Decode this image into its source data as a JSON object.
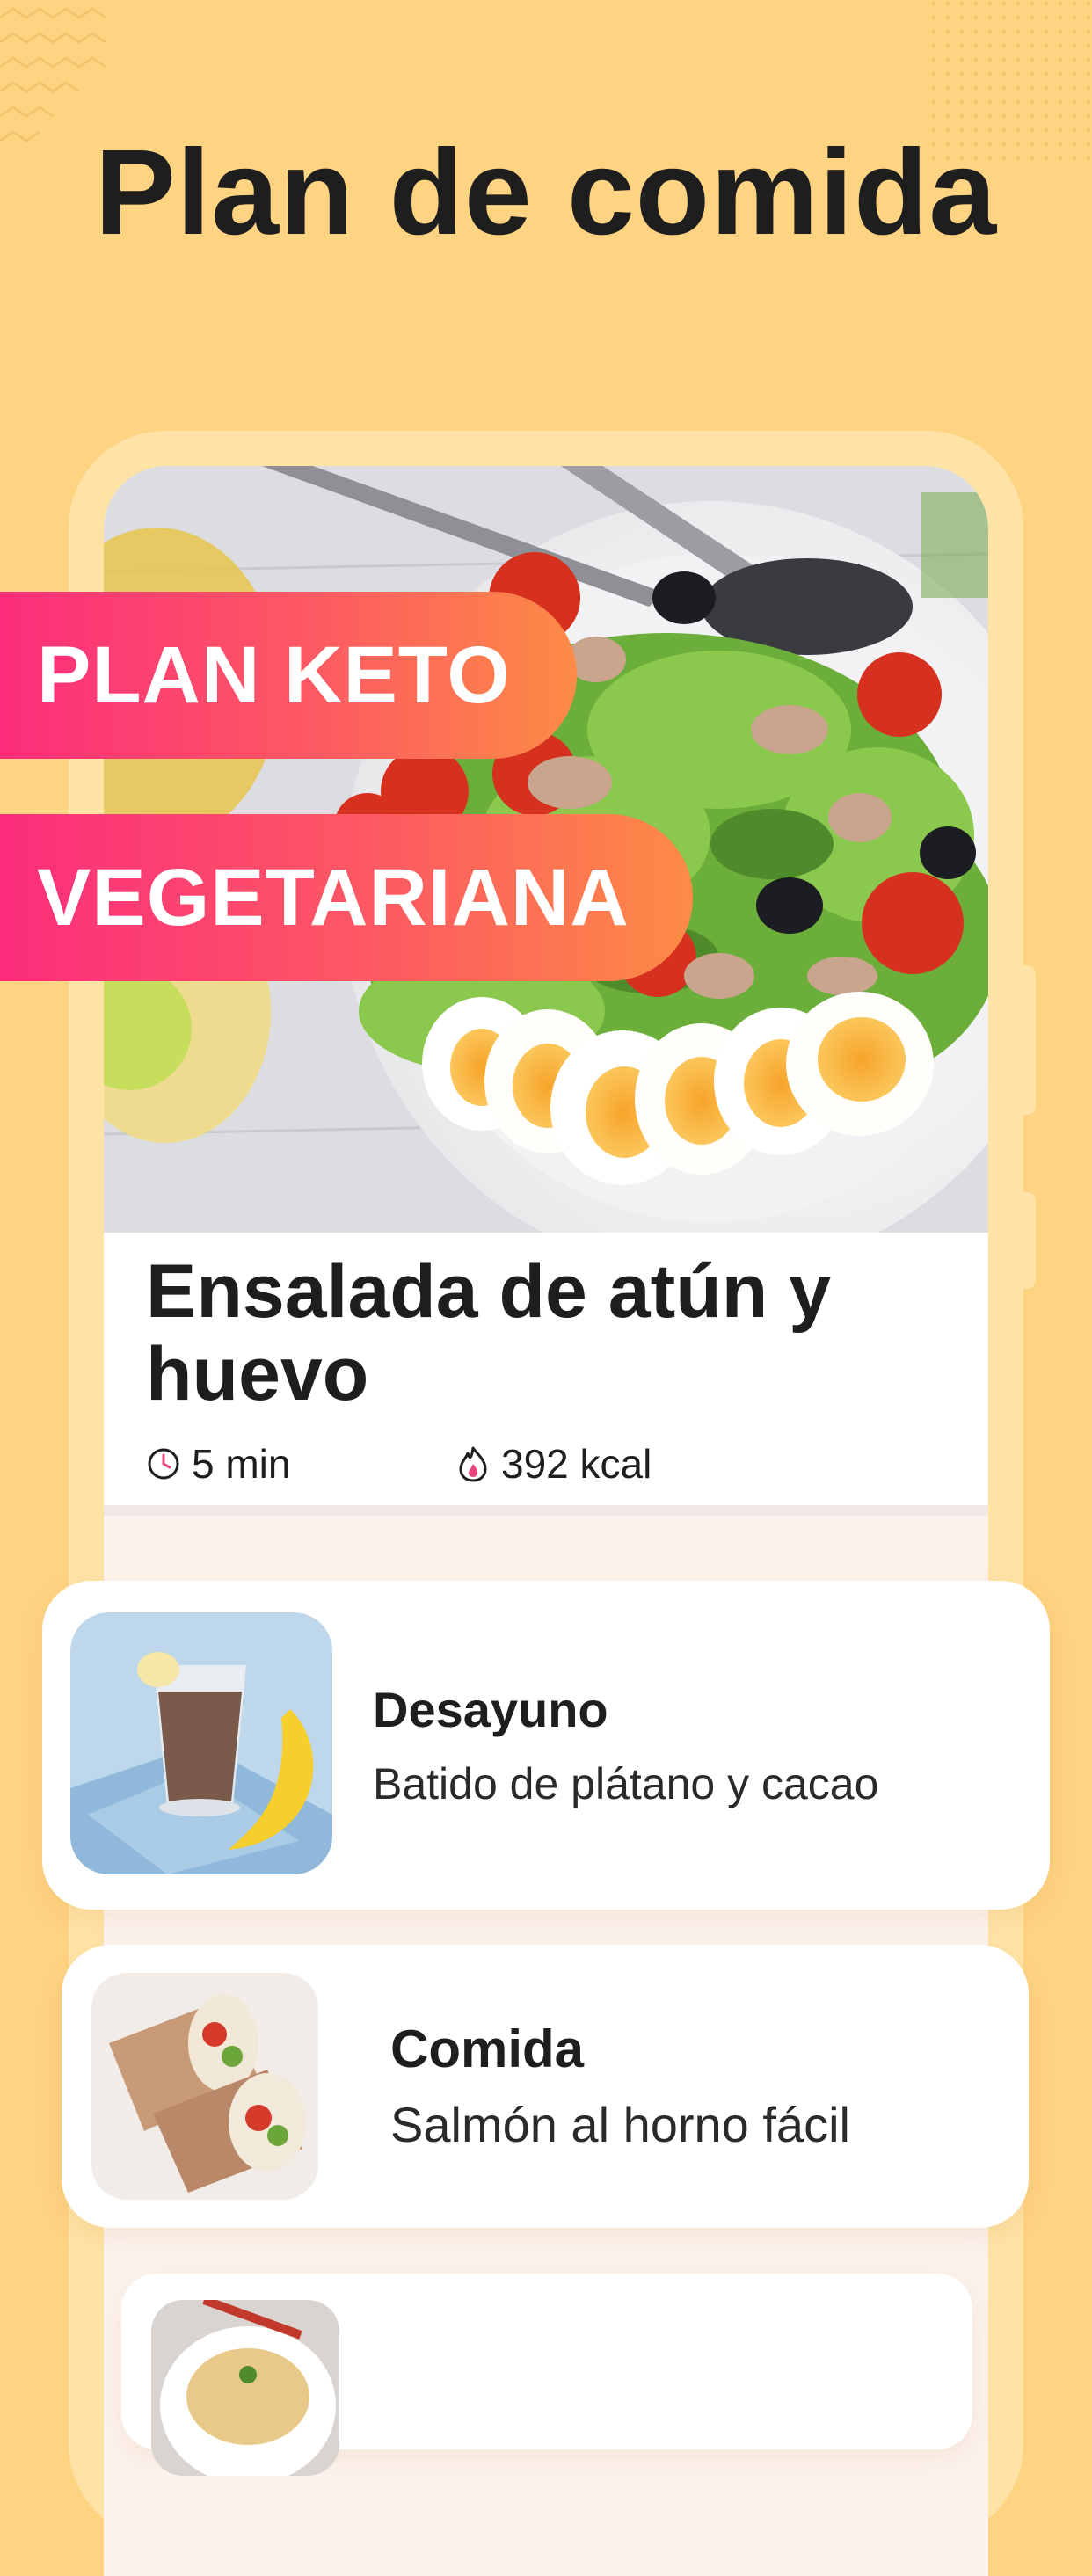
{
  "headline": "Plan de comida",
  "badges": {
    "keto": "PLAN KETO",
    "vegetarian": "VEGETARIANA"
  },
  "featured_recipe": {
    "title": "Ensalada de atún y huevo",
    "time": "5 min",
    "calories": "392 kcal"
  },
  "meals": [
    {
      "type": "Desayuno",
      "name": "Batido de plátano y cacao"
    },
    {
      "type": "Comida",
      "name": "Salmón al horno fácil"
    }
  ],
  "icons": {
    "time": "clock-icon",
    "calories": "flame-icon"
  },
  "colors": {
    "background": "#FED382",
    "frame": "#FFE3A6",
    "badge_gradient_start": "#FC2D7C",
    "badge_gradient_end": "#FD8B45",
    "text": "#1E1E1E"
  }
}
